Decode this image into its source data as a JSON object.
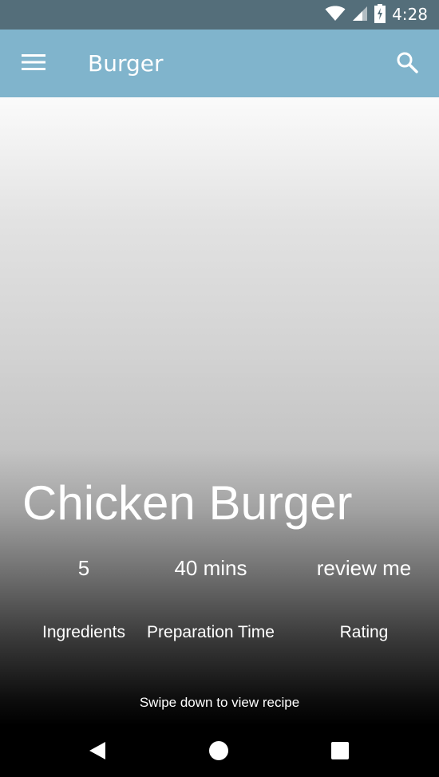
{
  "status_bar": {
    "time": "4:28",
    "icons": [
      "wifi-icon",
      "signal-icon",
      "battery-charging-icon"
    ]
  },
  "app_bar": {
    "title": "Burger",
    "menu_icon": "menu-icon",
    "search_icon": "search-icon",
    "color": "#80b4cc"
  },
  "recipe": {
    "title": "Chicken Burger",
    "stats": [
      {
        "value": "5",
        "label": "Ingredients"
      },
      {
        "value": "40 mins",
        "label": "Preparation Time"
      },
      {
        "value": "review me",
        "label": "Rating"
      }
    ],
    "swipe_hint": "Swipe down to view recipe"
  },
  "nav_bar": {
    "icons": [
      "back-icon",
      "home-icon",
      "recents-icon"
    ]
  }
}
